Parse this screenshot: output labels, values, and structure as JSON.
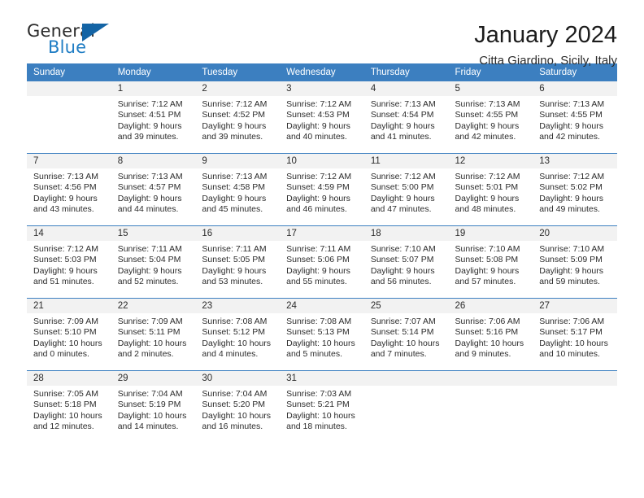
{
  "brand": {
    "name_part1": "General",
    "name_part2": "Blue",
    "mark_icon": "triangle-flag-icon",
    "accent_color": "#1f7dc4",
    "mark_color": "#1464a5"
  },
  "header": {
    "title": "January 2024",
    "subtitle": "Citta Giardino, Sicily, Italy"
  },
  "theme": {
    "header_row_color": "#3c7fc0",
    "daynum_band_color": "#f2f2f2",
    "text_color": "#2b2b2b"
  },
  "weekdays": [
    "Sunday",
    "Monday",
    "Tuesday",
    "Wednesday",
    "Thursday",
    "Friday",
    "Saturday"
  ],
  "weeks": [
    [
      {
        "day": "",
        "sunrise": "",
        "sunset": "",
        "daylight_line1": "",
        "daylight_line2": "",
        "empty": true
      },
      {
        "day": "1",
        "sunrise": "Sunrise: 7:12 AM",
        "sunset": "Sunset: 4:51 PM",
        "daylight_line1": "Daylight: 9 hours",
        "daylight_line2": "and 39 minutes."
      },
      {
        "day": "2",
        "sunrise": "Sunrise: 7:12 AM",
        "sunset": "Sunset: 4:52 PM",
        "daylight_line1": "Daylight: 9 hours",
        "daylight_line2": "and 39 minutes."
      },
      {
        "day": "3",
        "sunrise": "Sunrise: 7:12 AM",
        "sunset": "Sunset: 4:53 PM",
        "daylight_line1": "Daylight: 9 hours",
        "daylight_line2": "and 40 minutes."
      },
      {
        "day": "4",
        "sunrise": "Sunrise: 7:13 AM",
        "sunset": "Sunset: 4:54 PM",
        "daylight_line1": "Daylight: 9 hours",
        "daylight_line2": "and 41 minutes."
      },
      {
        "day": "5",
        "sunrise": "Sunrise: 7:13 AM",
        "sunset": "Sunset: 4:55 PM",
        "daylight_line1": "Daylight: 9 hours",
        "daylight_line2": "and 42 minutes."
      },
      {
        "day": "6",
        "sunrise": "Sunrise: 7:13 AM",
        "sunset": "Sunset: 4:55 PM",
        "daylight_line1": "Daylight: 9 hours",
        "daylight_line2": "and 42 minutes."
      }
    ],
    [
      {
        "day": "7",
        "sunrise": "Sunrise: 7:13 AM",
        "sunset": "Sunset: 4:56 PM",
        "daylight_line1": "Daylight: 9 hours",
        "daylight_line2": "and 43 minutes."
      },
      {
        "day": "8",
        "sunrise": "Sunrise: 7:13 AM",
        "sunset": "Sunset: 4:57 PM",
        "daylight_line1": "Daylight: 9 hours",
        "daylight_line2": "and 44 minutes."
      },
      {
        "day": "9",
        "sunrise": "Sunrise: 7:13 AM",
        "sunset": "Sunset: 4:58 PM",
        "daylight_line1": "Daylight: 9 hours",
        "daylight_line2": "and 45 minutes."
      },
      {
        "day": "10",
        "sunrise": "Sunrise: 7:12 AM",
        "sunset": "Sunset: 4:59 PM",
        "daylight_line1": "Daylight: 9 hours",
        "daylight_line2": "and 46 minutes."
      },
      {
        "day": "11",
        "sunrise": "Sunrise: 7:12 AM",
        "sunset": "Sunset: 5:00 PM",
        "daylight_line1": "Daylight: 9 hours",
        "daylight_line2": "and 47 minutes."
      },
      {
        "day": "12",
        "sunrise": "Sunrise: 7:12 AM",
        "sunset": "Sunset: 5:01 PM",
        "daylight_line1": "Daylight: 9 hours",
        "daylight_line2": "and 48 minutes."
      },
      {
        "day": "13",
        "sunrise": "Sunrise: 7:12 AM",
        "sunset": "Sunset: 5:02 PM",
        "daylight_line1": "Daylight: 9 hours",
        "daylight_line2": "and 49 minutes."
      }
    ],
    [
      {
        "day": "14",
        "sunrise": "Sunrise: 7:12 AM",
        "sunset": "Sunset: 5:03 PM",
        "daylight_line1": "Daylight: 9 hours",
        "daylight_line2": "and 51 minutes."
      },
      {
        "day": "15",
        "sunrise": "Sunrise: 7:11 AM",
        "sunset": "Sunset: 5:04 PM",
        "daylight_line1": "Daylight: 9 hours",
        "daylight_line2": "and 52 minutes."
      },
      {
        "day": "16",
        "sunrise": "Sunrise: 7:11 AM",
        "sunset": "Sunset: 5:05 PM",
        "daylight_line1": "Daylight: 9 hours",
        "daylight_line2": "and 53 minutes."
      },
      {
        "day": "17",
        "sunrise": "Sunrise: 7:11 AM",
        "sunset": "Sunset: 5:06 PM",
        "daylight_line1": "Daylight: 9 hours",
        "daylight_line2": "and 55 minutes."
      },
      {
        "day": "18",
        "sunrise": "Sunrise: 7:10 AM",
        "sunset": "Sunset: 5:07 PM",
        "daylight_line1": "Daylight: 9 hours",
        "daylight_line2": "and 56 minutes."
      },
      {
        "day": "19",
        "sunrise": "Sunrise: 7:10 AM",
        "sunset": "Sunset: 5:08 PM",
        "daylight_line1": "Daylight: 9 hours",
        "daylight_line2": "and 57 minutes."
      },
      {
        "day": "20",
        "sunrise": "Sunrise: 7:10 AM",
        "sunset": "Sunset: 5:09 PM",
        "daylight_line1": "Daylight: 9 hours",
        "daylight_line2": "and 59 minutes."
      }
    ],
    [
      {
        "day": "21",
        "sunrise": "Sunrise: 7:09 AM",
        "sunset": "Sunset: 5:10 PM",
        "daylight_line1": "Daylight: 10 hours",
        "daylight_line2": "and 0 minutes."
      },
      {
        "day": "22",
        "sunrise": "Sunrise: 7:09 AM",
        "sunset": "Sunset: 5:11 PM",
        "daylight_line1": "Daylight: 10 hours",
        "daylight_line2": "and 2 minutes."
      },
      {
        "day": "23",
        "sunrise": "Sunrise: 7:08 AM",
        "sunset": "Sunset: 5:12 PM",
        "daylight_line1": "Daylight: 10 hours",
        "daylight_line2": "and 4 minutes."
      },
      {
        "day": "24",
        "sunrise": "Sunrise: 7:08 AM",
        "sunset": "Sunset: 5:13 PM",
        "daylight_line1": "Daylight: 10 hours",
        "daylight_line2": "and 5 minutes."
      },
      {
        "day": "25",
        "sunrise": "Sunrise: 7:07 AM",
        "sunset": "Sunset: 5:14 PM",
        "daylight_line1": "Daylight: 10 hours",
        "daylight_line2": "and 7 minutes."
      },
      {
        "day": "26",
        "sunrise": "Sunrise: 7:06 AM",
        "sunset": "Sunset: 5:16 PM",
        "daylight_line1": "Daylight: 10 hours",
        "daylight_line2": "and 9 minutes."
      },
      {
        "day": "27",
        "sunrise": "Sunrise: 7:06 AM",
        "sunset": "Sunset: 5:17 PM",
        "daylight_line1": "Daylight: 10 hours",
        "daylight_line2": "and 10 minutes."
      }
    ],
    [
      {
        "day": "28",
        "sunrise": "Sunrise: 7:05 AM",
        "sunset": "Sunset: 5:18 PM",
        "daylight_line1": "Daylight: 10 hours",
        "daylight_line2": "and 12 minutes."
      },
      {
        "day": "29",
        "sunrise": "Sunrise: 7:04 AM",
        "sunset": "Sunset: 5:19 PM",
        "daylight_line1": "Daylight: 10 hours",
        "daylight_line2": "and 14 minutes."
      },
      {
        "day": "30",
        "sunrise": "Sunrise: 7:04 AM",
        "sunset": "Sunset: 5:20 PM",
        "daylight_line1": "Daylight: 10 hours",
        "daylight_line2": "and 16 minutes."
      },
      {
        "day": "31",
        "sunrise": "Sunrise: 7:03 AM",
        "sunset": "Sunset: 5:21 PM",
        "daylight_line1": "Daylight: 10 hours",
        "daylight_line2": "and 18 minutes."
      },
      {
        "day": "",
        "sunrise": "",
        "sunset": "",
        "daylight_line1": "",
        "daylight_line2": "",
        "empty": true
      },
      {
        "day": "",
        "sunrise": "",
        "sunset": "",
        "daylight_line1": "",
        "daylight_line2": "",
        "empty": true
      },
      {
        "day": "",
        "sunrise": "",
        "sunset": "",
        "daylight_line1": "",
        "daylight_line2": "",
        "empty": true
      }
    ]
  ]
}
